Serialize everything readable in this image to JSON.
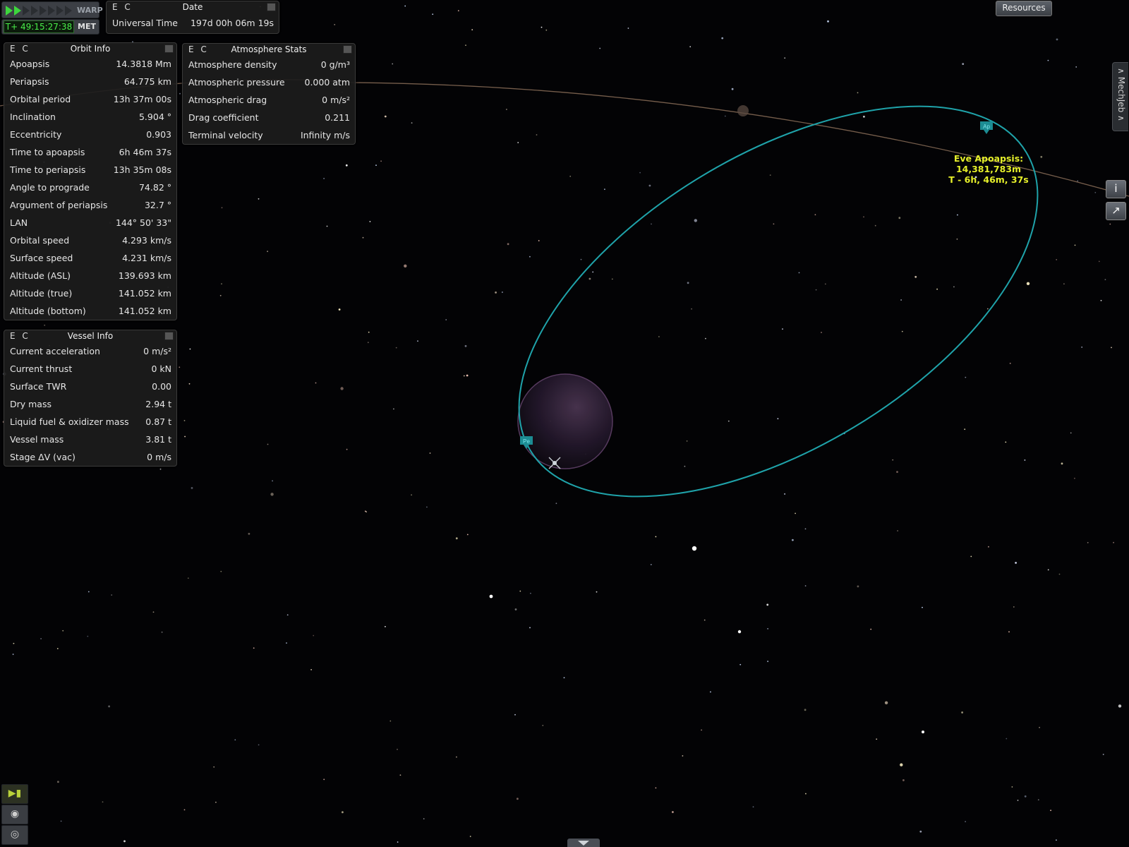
{
  "warp": {
    "label": "WARP",
    "speeds_total": 8,
    "speeds_active": 2
  },
  "met": {
    "time": "T+ 49:15:27:38",
    "label": "MET"
  },
  "date_window": {
    "ec": "E C",
    "title": "Date",
    "rows": [
      {
        "label": "Universal Time",
        "value": "197d 00h 06m 19s"
      }
    ]
  },
  "orbit_info": {
    "ec": "E C",
    "title": "Orbit Info",
    "rows": [
      {
        "label": "Apoapsis",
        "value": "14.3818 Mm"
      },
      {
        "label": "Periapsis",
        "value": "64.775 km"
      },
      {
        "label": "Orbital period",
        "value": "13h 37m 00s"
      },
      {
        "label": "Inclination",
        "value": "5.904 °"
      },
      {
        "label": "Eccentricity",
        "value": "0.903"
      },
      {
        "label": "Time to apoapsis",
        "value": "6h 46m 37s"
      },
      {
        "label": "Time to periapsis",
        "value": "13h 35m 08s"
      },
      {
        "label": "Angle to prograde",
        "value": "74.82 °"
      },
      {
        "label": "Argument of periapsis",
        "value": "32.7 °"
      },
      {
        "label": "LAN",
        "value": "144° 50' 33\""
      },
      {
        "label": "Orbital speed",
        "value": "4.293 km/s"
      },
      {
        "label": "Surface speed",
        "value": "4.231 km/s"
      },
      {
        "label": "Altitude (ASL)",
        "value": "139.693 km"
      },
      {
        "label": "Altitude (true)",
        "value": "141.052 km"
      },
      {
        "label": "Altitude (bottom)",
        "value": "141.052 km"
      }
    ]
  },
  "atmosphere_stats": {
    "ec": "E C",
    "title": "Atmosphere Stats",
    "rows": [
      {
        "label": "Atmosphere density",
        "value": "0 g/m³"
      },
      {
        "label": "Atmospheric pressure",
        "value": "0.000 atm"
      },
      {
        "label": "Atmospheric drag",
        "value": "0 m/s²"
      },
      {
        "label": "Drag coefficient",
        "value": "0.211"
      },
      {
        "label": "Terminal velocity",
        "value": "Infinity m/s"
      }
    ]
  },
  "vessel_info": {
    "ec": "E C",
    "title": "Vessel Info",
    "rows": [
      {
        "label": "Current acceleration",
        "value": "0 m/s²"
      },
      {
        "label": "Current thrust",
        "value": "0 kN"
      },
      {
        "label": "Surface TWR",
        "value": "0.00"
      },
      {
        "label": "Dry mass",
        "value": "2.94 t"
      },
      {
        "label": "Liquid fuel & oxidizer mass",
        "value": "0.87 t"
      },
      {
        "label": "Vessel mass",
        "value": "3.81 t"
      },
      {
        "label": "Stage ΔV (vac)",
        "value": "0 m/s"
      }
    ]
  },
  "resources_button": "Resources",
  "mechjeb_tab": "∧ MechJeb ∧",
  "side_buttons": {
    "info": "i",
    "maneuver": "↗"
  },
  "map_markers": {
    "apoapsis": "Ap",
    "periapsis": "Pe"
  },
  "apoapsis_label": {
    "line1": "Eve Apoapsis: 14,381,783m",
    "line2": "T - 6h, 46m, 37s"
  },
  "colors": {
    "orbit": "#1fa3aa",
    "sun_orbit": "#8a6d58",
    "label": "#e5ef2a",
    "met_text": "#49ef49",
    "planet": "#2a1a2c"
  }
}
